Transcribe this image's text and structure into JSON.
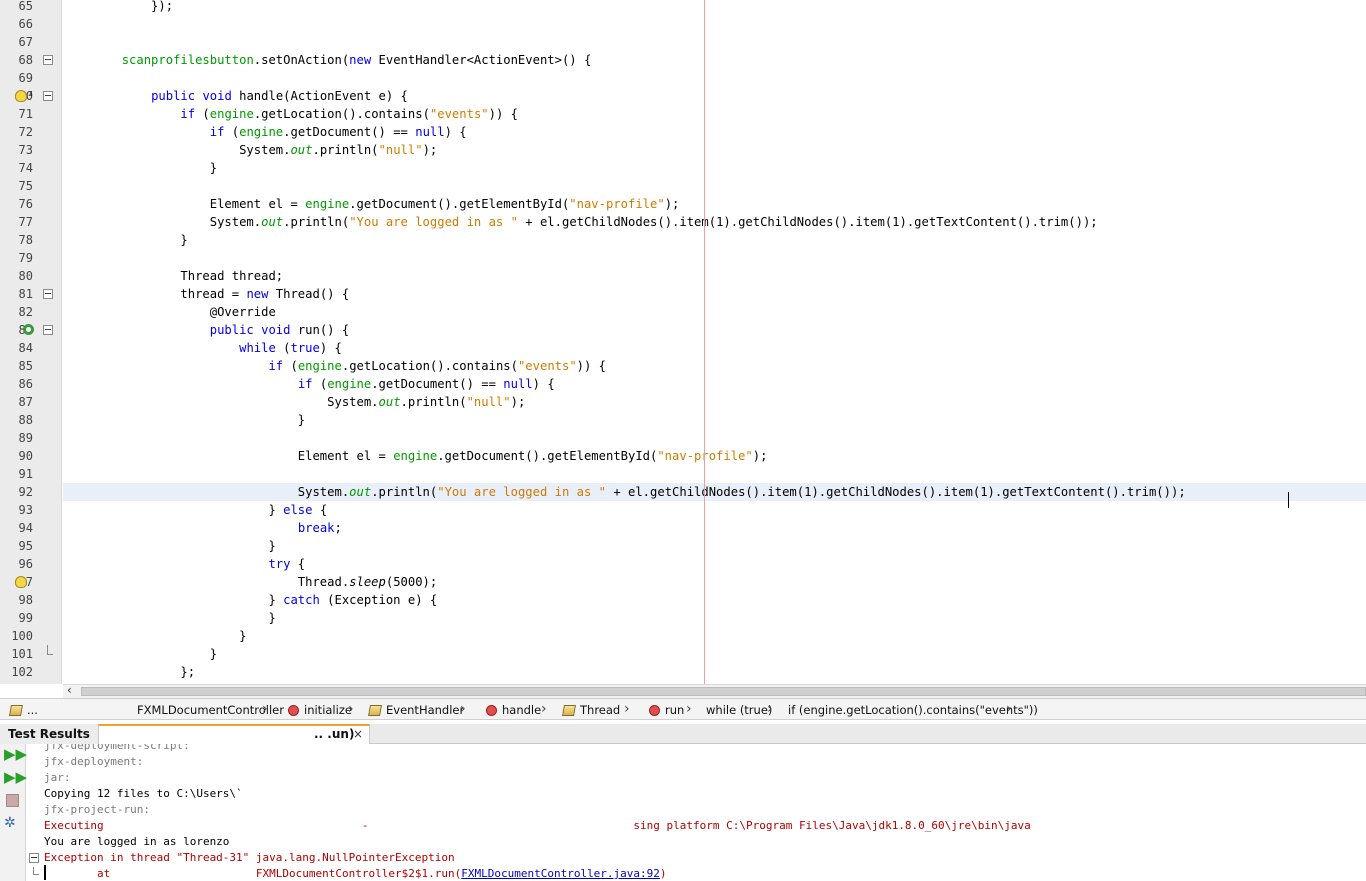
{
  "editor": {
    "lines": [
      {
        "n": "65",
        "html": "            });"
      },
      {
        "n": "66",
        "html": ""
      },
      {
        "n": "67",
        "html": ""
      },
      {
        "n": "68",
        "html": "        <span class='fld'>scanprofilesbutton</span>.setOnAction(<span class='kw'>new</span> EventHandler&lt;ActionEvent&gt;() {"
      },
      {
        "n": "69",
        "html": ""
      },
      {
        "n": "70",
        "html": "            <span class='kw'>public</span> <span class='kw'>void</span> handle(ActionEvent e) {"
      },
      {
        "n": "71",
        "html": "                <span class='kw'>if</span> (<span class='fld'>engine</span>.getLocation().contains(<span class='str'>\"events\"</span>)) {"
      },
      {
        "n": "72",
        "html": "                    <span class='kw'>if</span> (<span class='fld'>engine</span>.getDocument() == <span class='kw'>null</span>) {"
      },
      {
        "n": "73",
        "html": "                        System.<span class='stat'>out</span>.println(<span class='str'>\"null\"</span>);"
      },
      {
        "n": "74",
        "html": "                    }"
      },
      {
        "n": "75",
        "html": ""
      },
      {
        "n": "76",
        "html": "                    Element el = <span class='fld'>engine</span>.getDocument().getElementById(<span class='str'>\"nav-profile\"</span>);"
      },
      {
        "n": "77",
        "html": "                    System.<span class='stat'>out</span>.println(<span class='str'>\"You are logged in as \"</span> + el.getChildNodes().item(1).getChildNodes().item(1).getTextContent().trim());"
      },
      {
        "n": "78",
        "html": "                }"
      },
      {
        "n": "79",
        "html": ""
      },
      {
        "n": "80",
        "html": "                Thread thread;"
      },
      {
        "n": "81",
        "html": "                thread = <span class='kw'>new</span> Thread() {"
      },
      {
        "n": "82",
        "html": "                    @Override"
      },
      {
        "n": "83",
        "html": "                    <span class='kw'>public</span> <span class='kw'>void</span> run() {"
      },
      {
        "n": "84",
        "html": "                        <span class='kw'>while</span> (<span class='kw'>true</span>) {"
      },
      {
        "n": "85",
        "html": "                            <span class='kw'>if</span> (<span class='fld'>engine</span>.getLocation().contains(<span class='str'>\"events\"</span>)) {"
      },
      {
        "n": "86",
        "html": "                                <span class='kw'>if</span> (<span class='fld'>engine</span>.getDocument() == <span class='kw'>null</span>) {"
      },
      {
        "n": "87",
        "html": "                                    System.<span class='stat'>out</span>.println(<span class='str'>\"null\"</span>);"
      },
      {
        "n": "88",
        "html": "                                }"
      },
      {
        "n": "89",
        "html": ""
      },
      {
        "n": "90",
        "html": "                                Element el = <span class='fld'>engine</span>.getDocument().getElementById(<span class='str'>\"nav-profile\"</span>);"
      },
      {
        "n": "91",
        "html": ""
      },
      {
        "n": "92",
        "html": "                                System.<span class='stat'>out</span>.println(<span class='str'>\"You are logged in as \"</span> + el.getChildNodes().item(1).getChildNodes().item(1).getTextContent().trim());"
      },
      {
        "n": "93",
        "html": "                            } <span class='kw'>else</span> {"
      },
      {
        "n": "94",
        "html": "                                <span class='kw'>break</span>;"
      },
      {
        "n": "95",
        "html": "                            }"
      },
      {
        "n": "96",
        "html": "                            <span class='kw'>try</span> {"
      },
      {
        "n": "97",
        "html": "                                Thread.<span class='ital'>sleep</span>(5000);"
      },
      {
        "n": "98",
        "html": "                            } <span class='kw'>catch</span> (Exception e) {"
      },
      {
        "n": "99",
        "html": "                            }"
      },
      {
        "n": "100",
        "html": "                        }"
      },
      {
        "n": "101",
        "html": "                    }"
      },
      {
        "n": "102",
        "html": "                };"
      }
    ]
  },
  "breadcrumb": {
    "items": [
      {
        "label": "...",
        "icon": "class-icon"
      },
      {
        "label": "FXMLDocumentController",
        "icon": ""
      },
      {
        "label": "initialize",
        "icon": "method-icon"
      },
      {
        "label": "EventHandler",
        "icon": "class-icon"
      },
      {
        "label": "handle",
        "icon": "method-icon"
      },
      {
        "label": "Thread",
        "icon": "class-icon"
      },
      {
        "label": "run",
        "icon": "method-icon"
      },
      {
        "label": "while (true)",
        "icon": ""
      },
      {
        "label": "if (engine.getLocation().contains(\"events\"))",
        "icon": ""
      }
    ]
  },
  "panel": {
    "tab_test_results": "Test Results",
    "tab_run": ".. .un)",
    "tab_close": "×"
  },
  "output": {
    "lines": [
      {
        "text": "jfx-deployment-script:",
        "style": "gray"
      },
      {
        "text": "jfx-deployment:",
        "style": "gray"
      },
      {
        "text": "jar:",
        "style": "gray"
      },
      {
        "text": "Copying 12 files to C:\\Users\\`",
        "style": ""
      },
      {
        "text": "jfx-project-run:",
        "style": "gray"
      },
      {
        "text": "Executing                                       -                                        sing platform C:\\Program Files\\Java\\jdk1.8.0_60\\jre\\bin\\java",
        "style": "red"
      },
      {
        "text": "You are logged in as lorenzo",
        "style": ""
      },
      {
        "text": "Exception in thread \"Thread-31\" java.lang.NullPointerException",
        "style": "red"
      },
      {
        "text": "\tat                      FXMLDocumentController$2$1.run(",
        "style": "red",
        "link": "FXMLDocumentController.java:92",
        "tail": ")"
      }
    ]
  },
  "colors": {
    "keyword": "#0000e6",
    "string": "#ce7b00",
    "field": "#009900",
    "error": "#b00000"
  }
}
